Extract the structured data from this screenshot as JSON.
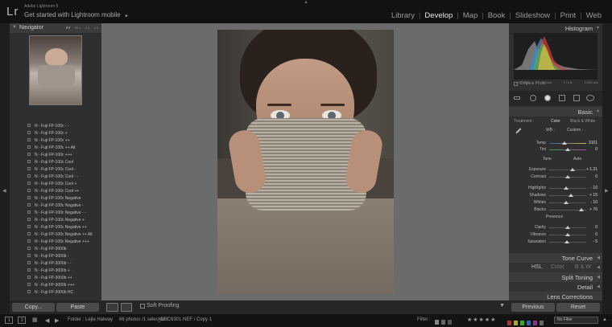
{
  "header": {
    "logo": "Lr",
    "brand": "Adobe Lightroom 5",
    "tagline": "Get started with Lightroom mobile",
    "tagline_arrow": "►",
    "modules": [
      "Library",
      "Develop",
      "Map",
      "Book",
      "Slideshow",
      "Print",
      "Web"
    ],
    "active_module": "Develop"
  },
  "navigator": {
    "title": "Navigator",
    "zoom_options": [
      "FIT",
      "FILL",
      "1:1",
      "1:4"
    ]
  },
  "presets": [
    "N - Fuji FP-100c - -",
    "N - Fuji FP-100c +",
    "N - Fuji FP-100c ++",
    "N - Fuji FP-100c ++ Alt",
    "N - Fuji FP-100c +++",
    "N - Fuji FP-100c Cool",
    "N - Fuji FP-100c Cool -",
    "N - Fuji FP-100c Cool - -",
    "N - Fuji FP-100c Cool +",
    "N - Fuji FP-100c Cool ++",
    "N - Fuji FP-100c Negative",
    "N - Fuji FP-100c Negative -",
    "N - Fuji FP-100c Negative - -",
    "N - Fuji FP-100c Negative +",
    "N - Fuji FP-100c Negative ++",
    "N - Fuji FP-100c Negative ++ Alt",
    "N - Fuji FP-100c Negative +++",
    "N - Fuji FP-3000b",
    "N - Fuji FP-3000b -",
    "N - Fuji FP-3000b - -",
    "N - Fuji FP-3000b +",
    "N - Fuji FP-3000b ++",
    "N - Fuji FP-3000b +++",
    "N - Fuji FP-3000b HC"
  ],
  "left_footer": {
    "copy": "Copy...",
    "paste": "Paste"
  },
  "toolbar": {
    "soft_proofing": "Soft Proofing"
  },
  "histogram": {
    "title": "Histogram",
    "iso": "ISO 200",
    "focal": "50 mm",
    "aperture": "f / 1.8",
    "shutter": "1/100 sec",
    "original_photo": "Original Photo"
  },
  "basic": {
    "title": "Basic",
    "treatment_label": "Treatment :",
    "treatment_color": "Color",
    "treatment_bw": "Black & White",
    "wb_label": "WB :",
    "wb_value": "Custom :",
    "tone_label": "Tone",
    "auto_label": "Auto",
    "presence_label": "Presence",
    "sliders": [
      {
        "label": "Temp",
        "value": "3101",
        "pos": 0.42
      },
      {
        "label": "Tint",
        "value": "0",
        "pos": 0.5
      },
      {
        "label": "Exposure",
        "value": "+ 1.31",
        "pos": 0.62
      },
      {
        "label": "Contrast",
        "value": "0",
        "pos": 0.5
      },
      {
        "label": "Highlights",
        "value": "- 10",
        "pos": 0.45
      },
      {
        "label": "Shadows",
        "value": "+ 15",
        "pos": 0.58
      },
      {
        "label": "Whites",
        "value": "- 10",
        "pos": 0.45
      },
      {
        "label": "Blacks",
        "value": "+ 76",
        "pos": 0.88
      },
      {
        "label": "Clarity",
        "value": "0",
        "pos": 0.5
      },
      {
        "label": "Vibrance",
        "value": "0",
        "pos": 0.5
      },
      {
        "label": "Saturation",
        "value": "- 5",
        "pos": 0.48
      }
    ]
  },
  "panels": {
    "tone_curve": "Tone Curve",
    "hsl": "HSL",
    "color": "Color",
    "bw": "B & W",
    "split_toning": "Split Toning",
    "detail": "Detail",
    "lens": "Lens Corrections"
  },
  "right_footer": {
    "previous": "Previous",
    "reset": "Reset"
  },
  "filmstrip": {
    "page1": "1",
    "page2": "2",
    "folder": "Folder : Lejla Halway",
    "count": "66 photos /1 selected /",
    "filename": "_DSC6301.NEF / Copy 1",
    "filter_label": "Filter :",
    "no_filter": "No Filter",
    "stars": "★★★★★"
  },
  "colors": {
    "active_module": "#e6e6e6",
    "panel_bg": "#2f2f2f",
    "center_bg": "#6b6b6b"
  }
}
